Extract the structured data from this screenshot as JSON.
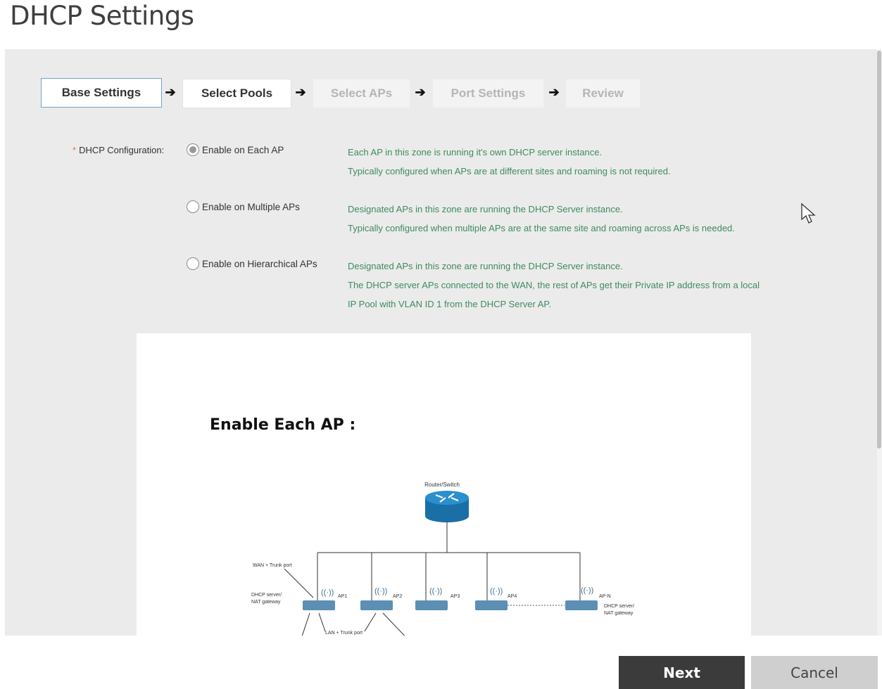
{
  "page": {
    "title": "DHCP Settings"
  },
  "wizard": {
    "steps": [
      {
        "label": "Base Settings",
        "state": "active"
      },
      {
        "label": "Select Pools",
        "state": "enabled"
      },
      {
        "label": "Select APs",
        "state": "disabled"
      },
      {
        "label": "Port Settings",
        "state": "disabled"
      },
      {
        "label": "Review",
        "state": "disabled"
      }
    ],
    "arrow_icon": "arrow-right-icon"
  },
  "config": {
    "required_marker": "*",
    "label": "DHCP Configuration:",
    "options": [
      {
        "label": "Enable on Each AP",
        "checked": true,
        "desc": [
          "Each AP in this zone is running it's own DHCP server instance.",
          "Typically configured when APs are at different sites and roaming is not required."
        ]
      },
      {
        "label": "Enable on Multiple APs",
        "checked": false,
        "desc": [
          "Designated APs in this zone are running the DHCP Server instance.",
          "Typically configured when multiple APs are at the same site and roaming across APs is needed."
        ]
      },
      {
        "label": "Enable on Hierarchical APs",
        "checked": false,
        "desc": [
          "Designated APs in this zone are running the DHCP Server instance.",
          "The DHCP server APs connected to the WAN, the rest of APs get their Private IP address from a local",
          "IP Pool with VLAN ID 1 from the DHCP Server AP."
        ]
      }
    ]
  },
  "diagram": {
    "title": "Enable Each AP :",
    "router_label": "Router/Switch",
    "wan_label": "WAN + Trunk port",
    "lan_label": "LAN + Trunk port",
    "dhcp_left_line1": "DHCP server/",
    "dhcp_left_line2": "NAT gateway",
    "dhcp_right_line1": "DHCP server/",
    "dhcp_right_line2": "NAT gateway",
    "aps": [
      "AP1",
      "AP2",
      "AP3",
      "AP4",
      "AP-N"
    ],
    "ap_icon": "wifi-ap-icon",
    "router_icon": "router-icon"
  },
  "buttons": {
    "next": "Next",
    "cancel": "Cancel"
  },
  "colors": {
    "desc_text": "#3f8b5f",
    "router": "#1f7fb8",
    "required": "#e07b39"
  }
}
